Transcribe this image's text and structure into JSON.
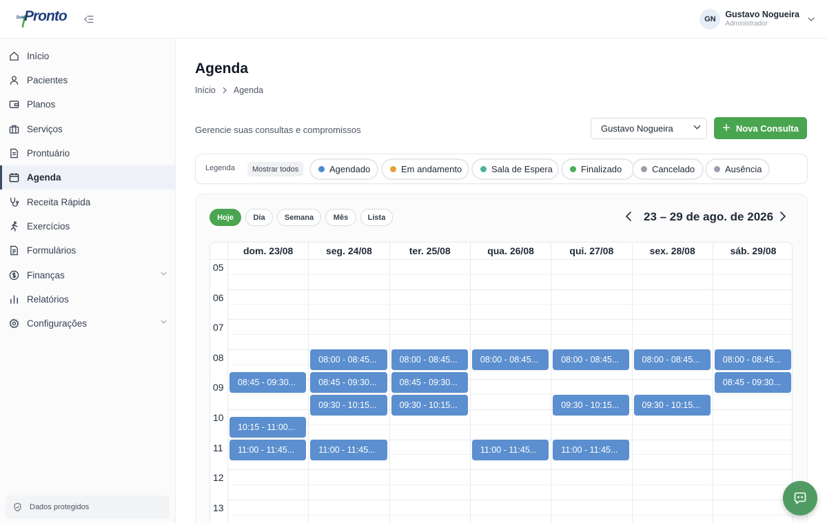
{
  "brand": {
    "logo_small": "Doko",
    "logo_text": "Pronto"
  },
  "user": {
    "initials": "GN",
    "name": "Gustavo Nogueira",
    "role": "Administrador"
  },
  "sidebar": {
    "items": [
      {
        "label": "Início",
        "icon": "home-icon"
      },
      {
        "label": "Pacientes",
        "icon": "user-icon"
      },
      {
        "label": "Planos",
        "icon": "wallet-icon"
      },
      {
        "label": "Serviços",
        "icon": "briefcase-icon"
      },
      {
        "label": "Prontuário",
        "icon": "document-icon"
      },
      {
        "label": "Agenda",
        "icon": "calendar-icon",
        "active": true
      },
      {
        "label": "Receita Rápida",
        "icon": "stethoscope-icon"
      },
      {
        "label": "Exercícios",
        "icon": "running-icon"
      },
      {
        "label": "Formulários",
        "icon": "form-icon"
      },
      {
        "label": "Finanças",
        "icon": "dollar-icon",
        "expandable": true
      },
      {
        "label": "Relatórios",
        "icon": "bar-chart-icon"
      },
      {
        "label": "Configurações",
        "icon": "gear-icon",
        "expandable": true
      }
    ],
    "footer": "Dados protegidos"
  },
  "page": {
    "title": "Agenda",
    "breadcrumb": [
      "Início",
      "Agenda"
    ],
    "subtitle": "Gerencie suas consultas e compromissos",
    "doctor_select": "Gustavo Nogueira",
    "new_button": "Nova Consulta"
  },
  "legend": {
    "label": "Legenda",
    "show_all": "Mostrar todos",
    "statuses": [
      {
        "label": "Agendado",
        "color": "#4a8bd6"
      },
      {
        "label": "Em andamento",
        "color": "#e4a23a"
      },
      {
        "label": "Sala de Espera",
        "color": "#4cb39a"
      },
      {
        "label": "Finalizado",
        "color": "#4cae5a"
      },
      {
        "label": "Cancelado",
        "color": "#9aa0a6"
      },
      {
        "label": "Ausência",
        "color": "#9aa0ab"
      }
    ]
  },
  "calendar": {
    "views": [
      "Hoje",
      "Dia",
      "Semana",
      "Mês",
      "Lista"
    ],
    "active_view": "Hoje",
    "range_label": "23 – 29 de ago. de 2026",
    "days": [
      "dom. 23/08",
      "seg. 24/08",
      "ter. 25/08",
      "qua. 26/08",
      "qui. 27/08",
      "sex. 28/08",
      "sáb. 29/08"
    ],
    "hours": [
      "05",
      "06",
      "07",
      "08",
      "09",
      "10",
      "11",
      "12",
      "13"
    ],
    "event_color": "#5b8fcf",
    "events": [
      {
        "day": 0,
        "start": 8.75,
        "label": "08:45 - 09:30..."
      },
      {
        "day": 0,
        "start": 10.25,
        "label": "10:15 - 11:00..."
      },
      {
        "day": 0,
        "start": 11.0,
        "label": "11:00 - 11:45..."
      },
      {
        "day": 1,
        "start": 8.0,
        "label": "08:00 - 08:45..."
      },
      {
        "day": 1,
        "start": 8.75,
        "label": "08:45 - 09:30..."
      },
      {
        "day": 1,
        "start": 9.5,
        "label": "09:30 - 10:15..."
      },
      {
        "day": 1,
        "start": 11.0,
        "label": "11:00 - 11:45..."
      },
      {
        "day": 2,
        "start": 8.0,
        "label": "08:00 - 08:45..."
      },
      {
        "day": 2,
        "start": 8.75,
        "label": "08:45 - 09:30..."
      },
      {
        "day": 2,
        "start": 9.5,
        "label": "09:30 - 10:15..."
      },
      {
        "day": 3,
        "start": 8.0,
        "label": "08:00 - 08:45..."
      },
      {
        "day": 3,
        "start": 11.0,
        "label": "11:00 - 11:45..."
      },
      {
        "day": 4,
        "start": 8.0,
        "label": "08:00 - 08:45..."
      },
      {
        "day": 4,
        "start": 9.5,
        "label": "09:30 - 10:15..."
      },
      {
        "day": 4,
        "start": 11.0,
        "label": "11:00 - 11:45..."
      },
      {
        "day": 5,
        "start": 8.0,
        "label": "08:00 - 08:45..."
      },
      {
        "day": 5,
        "start": 9.5,
        "label": "09:30 - 10:15..."
      },
      {
        "day": 6,
        "start": 8.0,
        "label": "08:00 - 08:45..."
      },
      {
        "day": 6,
        "start": 8.75,
        "label": "08:45 - 09:30..."
      }
    ]
  }
}
